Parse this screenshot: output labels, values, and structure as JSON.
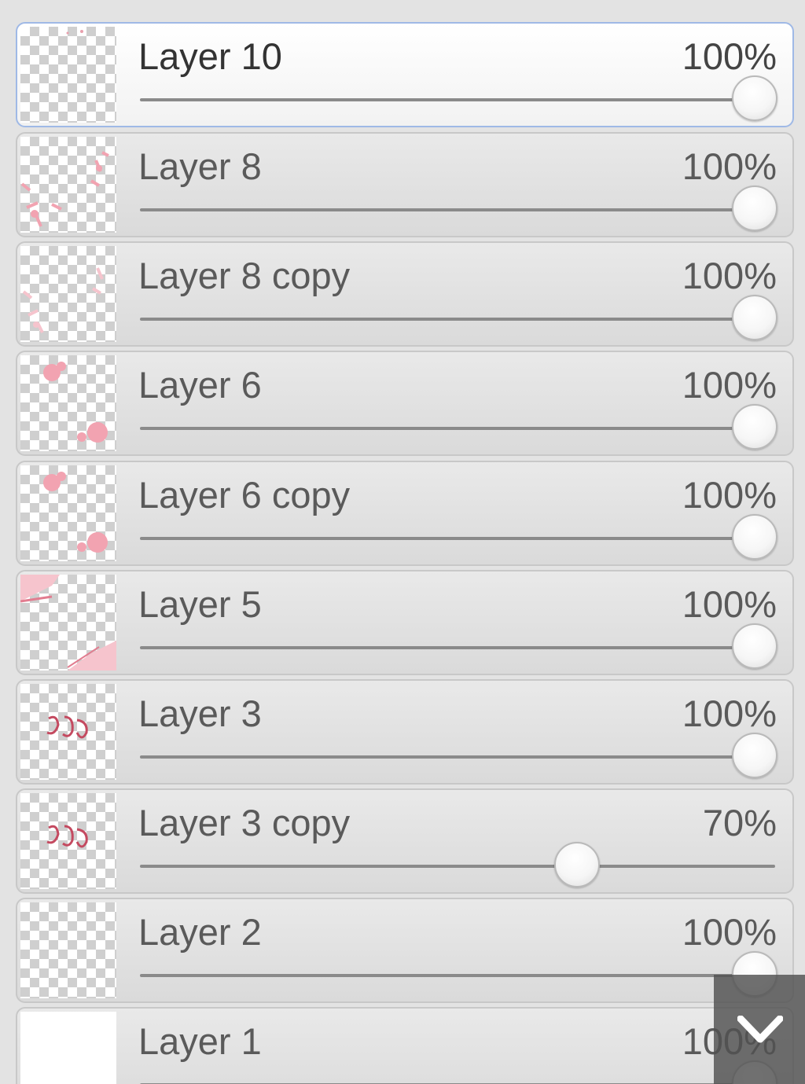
{
  "layers": [
    {
      "name": "Layer 10",
      "opacity_label": "100%",
      "opacity": 1.0,
      "selected": true,
      "thumbnail": "transparent-specks"
    },
    {
      "name": "Layer 8",
      "opacity_label": "100%",
      "opacity": 1.0,
      "selected": false,
      "thumbnail": "pink-splatter"
    },
    {
      "name": "Layer 8 copy",
      "opacity_label": "100%",
      "opacity": 1.0,
      "selected": false,
      "thumbnail": "pink-splatter-light"
    },
    {
      "name": "Layer 6",
      "opacity_label": "100%",
      "opacity": 1.0,
      "selected": false,
      "thumbnail": "pink-blobs"
    },
    {
      "name": "Layer 6 copy",
      "opacity_label": "100%",
      "opacity": 1.0,
      "selected": false,
      "thumbnail": "pink-blobs"
    },
    {
      "name": "Layer 5",
      "opacity_label": "100%",
      "opacity": 1.0,
      "selected": false,
      "thumbnail": "pink-corners"
    },
    {
      "name": "Layer 3",
      "opacity_label": "100%",
      "opacity": 1.0,
      "selected": false,
      "thumbnail": "red-scribble"
    },
    {
      "name": "Layer 3 copy",
      "opacity_label": "70%",
      "opacity": 0.7,
      "selected": false,
      "thumbnail": "red-scribble"
    },
    {
      "name": "Layer 2",
      "opacity_label": "100%",
      "opacity": 1.0,
      "selected": false,
      "thumbnail": "transparent"
    },
    {
      "name": "Layer 1",
      "opacity_label": "100%",
      "opacity": 1.0,
      "selected": false,
      "thumbnail": "white"
    }
  ],
  "scroll_button": {
    "icon": "chevron-down-icon"
  },
  "colors": {
    "selected_border": "#9fb9e6",
    "thumbnail_accent": "#f2a3b1",
    "scroll_button_bg": "#505050"
  }
}
